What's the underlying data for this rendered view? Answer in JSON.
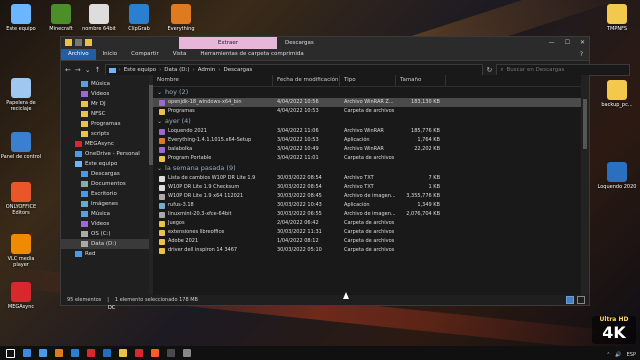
{
  "desktop_icons": [
    {
      "label": "Este equipo",
      "color": "#6cb6ff"
    },
    {
      "label": "Minecraft",
      "color": "#4a8f2a"
    },
    {
      "label": "nombre 64bit",
      "color": "#ddd"
    },
    {
      "label": "ClipGrab",
      "color": "#2a7fd0"
    },
    {
      "label": "Everything",
      "color": "#e07a20"
    },
    {
      "label": "Papelera de reciclaje",
      "color": "#9fc7ef"
    },
    {
      "label": "Panel de control",
      "color": "#3a7fd0"
    },
    {
      "label": "ONLYOFFICE Editors",
      "color": "#e8562a"
    },
    {
      "label": "VLC media player",
      "color": "#f08a00"
    },
    {
      "label": "MEGAsync",
      "color": "#d9272e"
    },
    {
      "label": "TMPNFS",
      "color": "#f2c94c"
    },
    {
      "label": "backup_pc...",
      "color": "#f2c94c"
    },
    {
      "label": "Loquendo 2020",
      "color": "#2a6fc0"
    }
  ],
  "ribbon": {
    "context_tab": "Extraer",
    "window_title": "Descargas",
    "tabs": [
      "Archivo",
      "Inicio",
      "Compartir",
      "Vista",
      "Herramientas de carpeta comprimida"
    ],
    "help": "?"
  },
  "address": {
    "segments": [
      "Este equipo",
      "Data (D:)",
      "Admin",
      "Descargas"
    ],
    "search_placeholder": "Buscar en Descargas"
  },
  "nav": [
    {
      "label": "Música",
      "level": 2,
      "color": "#5aa0e0"
    },
    {
      "label": "Vídeos",
      "level": 2,
      "color": "#9a6ad0"
    },
    {
      "label": "Mr DJ",
      "level": 2,
      "color": "#e8c24a"
    },
    {
      "label": "NFSC",
      "level": 2,
      "color": "#e8c24a"
    },
    {
      "label": "Programas",
      "level": 2,
      "color": "#e8c24a"
    },
    {
      "label": "scripts",
      "level": 2,
      "color": "#e8c24a"
    },
    {
      "label": "MEGAsync",
      "level": 1,
      "color": "#d9272e"
    },
    {
      "label": "OneDrive - Personal",
      "level": 1,
      "color": "#4a9ae8"
    },
    {
      "label": "Este equipo",
      "level": 1,
      "color": "#6cb6ff"
    },
    {
      "label": "Descargas",
      "level": 2,
      "color": "#4a9ae8"
    },
    {
      "label": "Documentos",
      "level": 2,
      "color": "#8aa"
    },
    {
      "label": "Escritorio",
      "level": 2,
      "color": "#4a9ae8"
    },
    {
      "label": "Imágenes",
      "level": 2,
      "color": "#6ac"
    },
    {
      "label": "Música",
      "level": 2,
      "color": "#5aa0e0"
    },
    {
      "label": "Vídeos",
      "level": 2,
      "color": "#9a6ad0"
    },
    {
      "label": "OS (C:)",
      "level": 2,
      "color": "#aaa"
    },
    {
      "label": "Data (D:)",
      "level": 2,
      "color": "#aaa",
      "selected": true
    },
    {
      "label": "Red",
      "level": 1,
      "color": "#4a9ae8"
    }
  ],
  "columns": {
    "name": "Nombre",
    "date": "Fecha de modificación",
    "type": "Tipo",
    "size": "Tamaño"
  },
  "groups": [
    {
      "label": "hoy (2)",
      "rows": [
        {
          "name": "openjdk-18_windows-x64_bin",
          "date": "4/04/2022 10:56",
          "type": "Archivo WinRAR Z...",
          "size": "183,130 KB",
          "icon": "#9b6ad0",
          "selected": true
        },
        {
          "name": "Programas",
          "date": "4/04/2022 10:53",
          "type": "Carpeta de archivos",
          "size": "",
          "icon": "#e8c24a"
        }
      ]
    },
    {
      "label": "ayer (4)",
      "rows": [
        {
          "name": "Loquendo 2021",
          "date": "3/04/2022 11:06",
          "type": "Archivo WinRAR",
          "size": "185,776 KB",
          "icon": "#9b6ad0"
        },
        {
          "name": "Everything-1.4.1.1015.x64-Setup",
          "date": "3/04/2022 10:53",
          "type": "Aplicación",
          "size": "1,764 KB",
          "icon": "#e07a20"
        },
        {
          "name": "balabolka",
          "date": "3/04/2022 10:49",
          "type": "Archivo WinRAR",
          "size": "22,202 KB",
          "icon": "#9b6ad0"
        },
        {
          "name": "Program Portable",
          "date": "3/04/2022 11:01",
          "type": "Carpeta de archivos",
          "size": "",
          "icon": "#e8c24a"
        }
      ]
    },
    {
      "label": "la semana pasada (9)",
      "rows": [
        {
          "name": "Lista de cambios W10P DR Lite 1.9",
          "date": "30/03/2022 08:54",
          "type": "Archivo TXT",
          "size": "7 KB",
          "icon": "#ddd"
        },
        {
          "name": "W10P DR Lite 1.9 Checksum",
          "date": "30/03/2022 08:54",
          "type": "Archivo TXT",
          "size": "1 KB",
          "icon": "#ddd"
        },
        {
          "name": "W10P DR Lite 1.9 x64 112021",
          "date": "30/03/2022 08:45",
          "type": "Archivo de imagen...",
          "size": "3,355,776 KB",
          "icon": "#aaa"
        },
        {
          "name": "rufus-3.18",
          "date": "30/03/2022 10:43",
          "type": "Aplicación",
          "size": "1,349 KB",
          "icon": "#7ac"
        },
        {
          "name": "linuxmint-20.3-xfce-64bit",
          "date": "30/03/2022 06:55",
          "type": "Archivo de imagen...",
          "size": "2,076,704 KB",
          "icon": "#aaa"
        },
        {
          "name": "Juegos",
          "date": "2/04/2022 06:42",
          "type": "Carpeta de archivos",
          "size": "",
          "icon": "#e8c24a"
        },
        {
          "name": "extensiones libreoffice",
          "date": "30/03/2022 11:31",
          "type": "Carpeta de archivos",
          "size": "",
          "icon": "#e8c24a"
        },
        {
          "name": "Adobe 2021",
          "date": "1/04/2022 08:12",
          "type": "Carpeta de archivos",
          "size": "",
          "icon": "#e8c24a"
        },
        {
          "name": "driver dell inspiron 14 3467",
          "date": "30/03/2022 05:10",
          "type": "Carpeta de archivos",
          "size": "",
          "icon": "#e8c24a"
        }
      ]
    }
  ],
  "status": {
    "items": "95 elementos",
    "selected": "1 elemento seleccionado  178 MB"
  },
  "dc_label": "DC",
  "tray": {
    "lang": "ESP"
  },
  "badge": {
    "top": "Ultra HD",
    "bottom": "4K"
  },
  "taskbar_icons": [
    "#fff",
    "#3a8ae0",
    "#4a9ae8",
    "#e07a20",
    "#2a7fd0",
    "#d9272e",
    "#1e6fc0",
    "#e8c24a",
    "#d9272e",
    "#ff5a2a",
    "#4a4a4a",
    "#888"
  ]
}
